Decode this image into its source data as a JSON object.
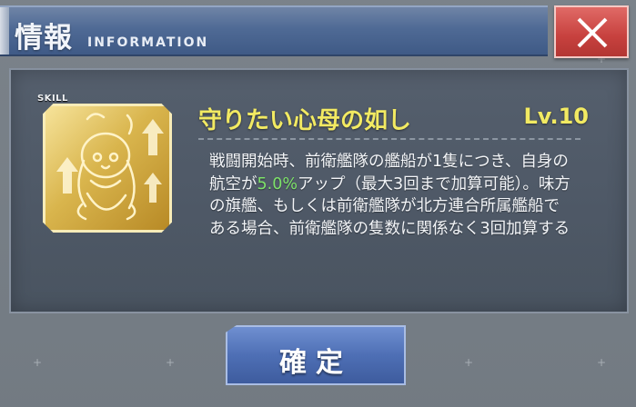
{
  "header": {
    "title": "情報",
    "subtitle": "INFORMATION"
  },
  "close_icon": "close-x-icon",
  "skill": {
    "tag": "SKILL",
    "icon": "skill-portrait-icon",
    "name": "守りたい心母の如し",
    "level": "Lv.10",
    "description": {
      "part1": "戦闘開始時、前衛艦隊の艦船が1隻につき、自身の航空が",
      "highlight": "5.0%",
      "part2": "アップ（最大3回まで加算可能）。味方の旗艦、もしくは前衛艦隊が北方連合所属艦船である場合、前衛艦隊の隻数に関係なく3回加算する"
    }
  },
  "confirm_button": {
    "label": "確定"
  },
  "colors": {
    "header": "#4f6a95",
    "close": "#c7413e",
    "skill_name": "#f2ea62",
    "highlight": "#7ee36a",
    "confirm": "#4e6fb5"
  }
}
